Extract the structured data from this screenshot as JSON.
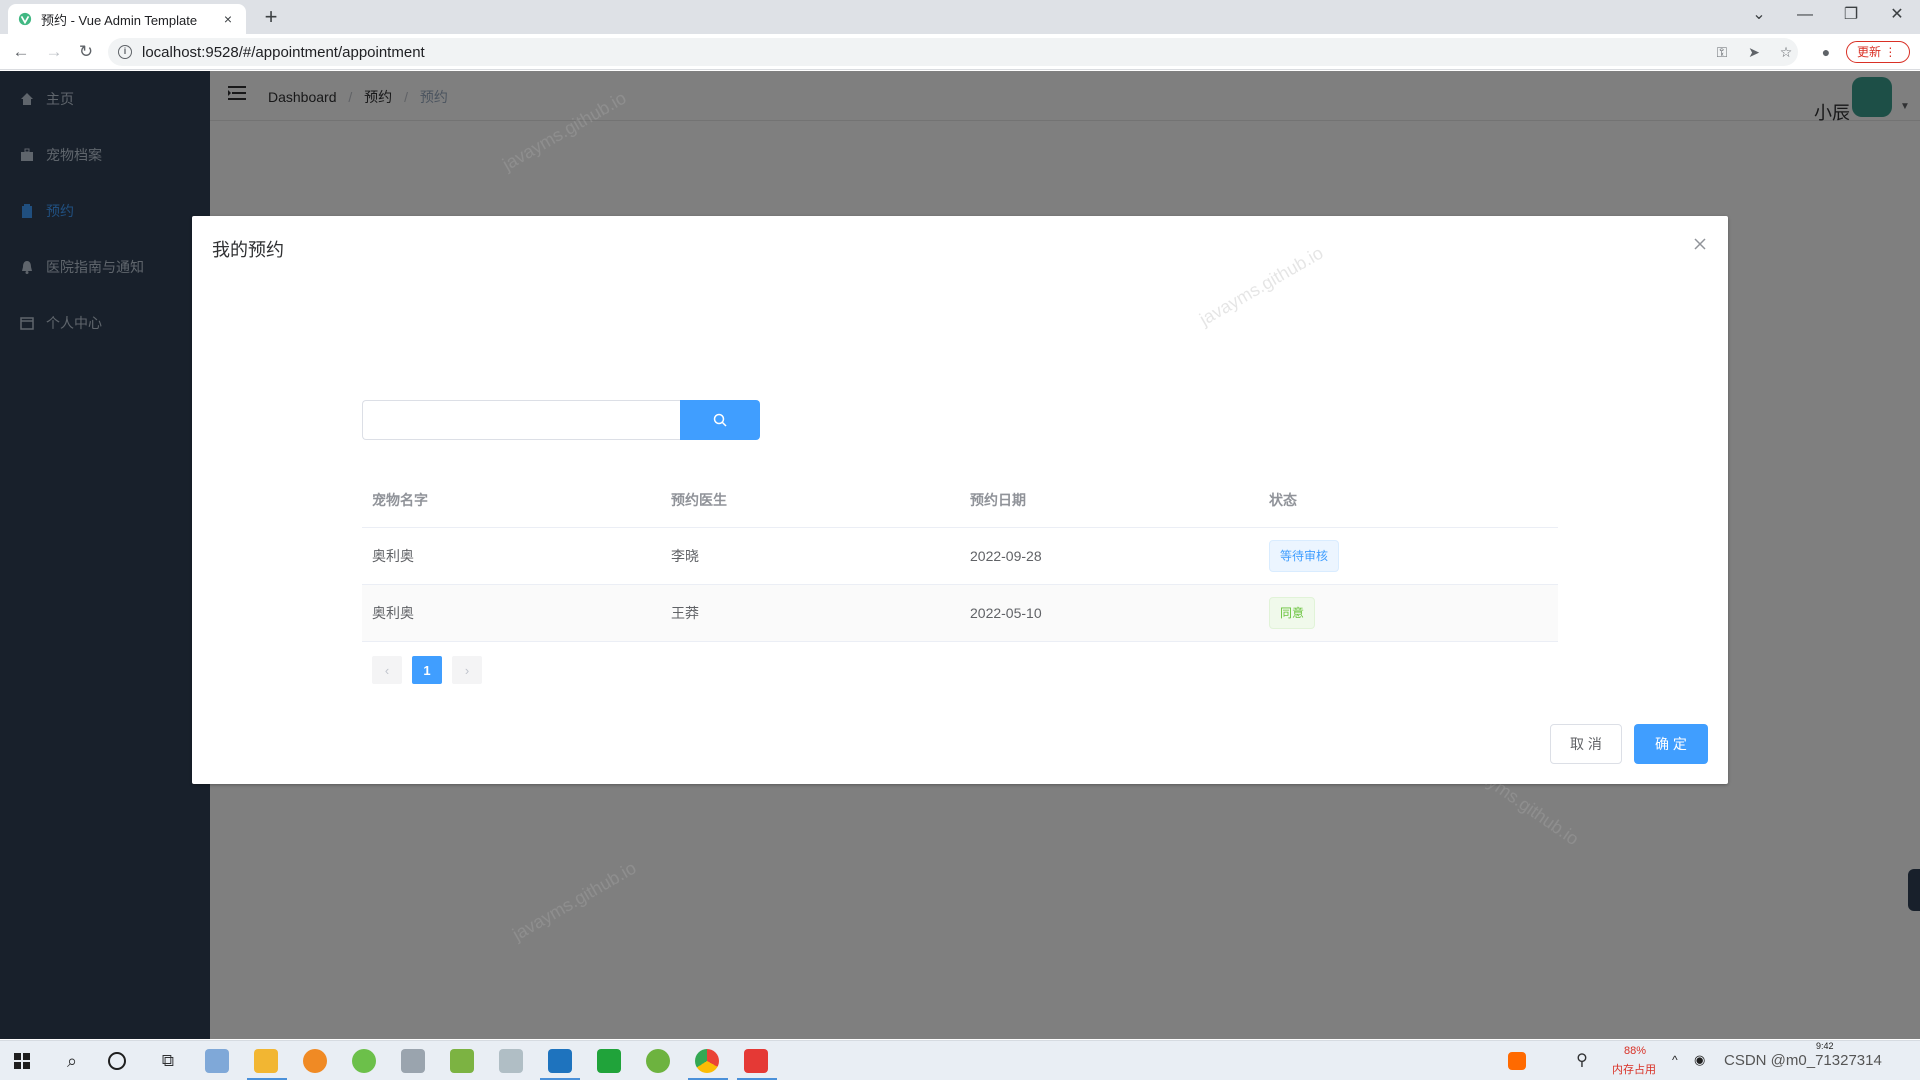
{
  "browser": {
    "tab_title": "预约 - Vue Admin Template",
    "tab_close": "×",
    "new_tab": "+",
    "url": "localhost:9528/#/appointment/appointment",
    "update_label": "更新 ⋮",
    "window_controls": [
      "⌄",
      "—",
      "❐",
      "✕"
    ]
  },
  "sidebar": {
    "items": [
      {
        "label": "主页",
        "icon": "home-icon",
        "active": false
      },
      {
        "label": "宠物档案",
        "icon": "briefcase-icon",
        "active": false
      },
      {
        "label": "预约",
        "icon": "clipboard-icon",
        "active": true
      },
      {
        "label": "医院指南与通知",
        "icon": "bell-icon",
        "active": false
      },
      {
        "label": "个人中心",
        "icon": "calendar-icon",
        "active": false
      }
    ]
  },
  "navbar": {
    "breadcrumb": [
      "Dashboard",
      "预约",
      "预约"
    ],
    "breadcrumb_sep": "/",
    "user_name": "小辰"
  },
  "watermark_text": "javayms.github.io",
  "dialog": {
    "title": "我的预约",
    "search": {
      "placeholder": "",
      "value": ""
    },
    "table": {
      "columns": [
        "宠物名字",
        "预约医生",
        "预约日期",
        "状态"
      ],
      "rows": [
        {
          "pet": "奥利奥",
          "doctor": "李晓",
          "date": "2022-09-28",
          "status": "等待审核",
          "status_type": "info"
        },
        {
          "pet": "奥利奥",
          "doctor": "王莽",
          "date": "2022-05-10",
          "status": "同意",
          "status_type": "success"
        }
      ]
    },
    "pagination": {
      "prev": "‹",
      "current": "1",
      "next": "›"
    },
    "cancel_label": "取 消",
    "confirm_label": "确 定"
  },
  "taskbar": {
    "memory_percent": "88%",
    "memory_label": "内存占用",
    "tray_text": "CSDN @m0_71327314",
    "clock": "9:42"
  },
  "colors": {
    "primary": "#409eff",
    "sidebar_bg": "#304156",
    "success": "#67c23a",
    "danger": "#d93025"
  }
}
